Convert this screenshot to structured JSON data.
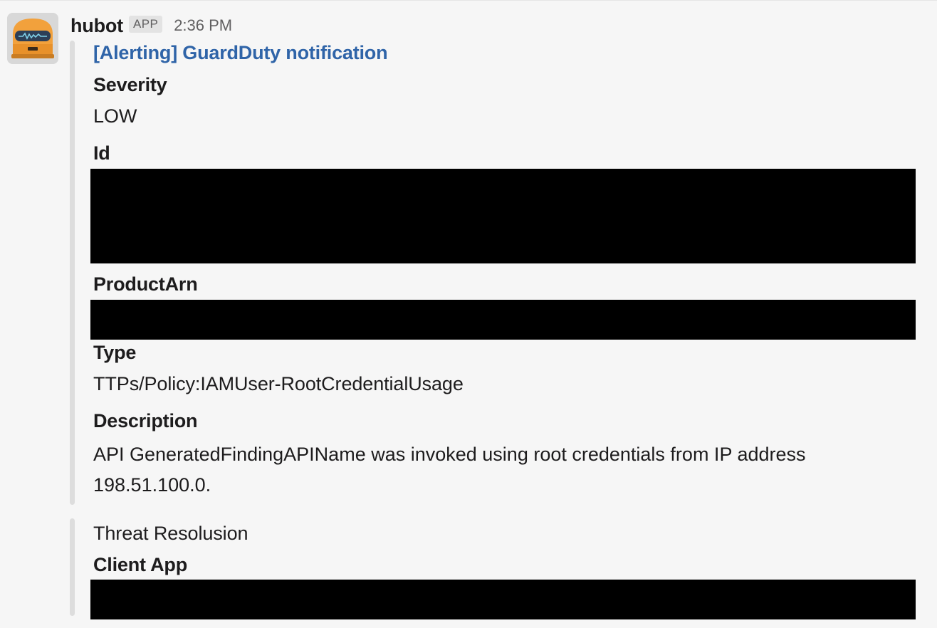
{
  "message": {
    "sender": "hubot",
    "badge": "APP",
    "time": "2:36 PM",
    "avatar_icon": "robot-avatar-icon"
  },
  "attachment1": {
    "title": "[Alerting] GuardDuty notification",
    "fields": {
      "severity_label": "Severity",
      "severity_value": "LOW",
      "id_label": "Id",
      "product_arn_label": "ProductArn",
      "type_label": "Type",
      "type_value": "TTPs/Policy:IAMUser-RootCredentialUsage",
      "description_label": "Description",
      "description_value": "API GeneratedFindingAPIName was invoked using root credentials from IP address 198.51.100.0."
    }
  },
  "attachment2": {
    "text": "Threat Resolusion",
    "client_app_label": "Client App"
  },
  "colors": {
    "link": "#2f64a8",
    "text": "#1d1c1d",
    "muted": "#616061",
    "bar": "#dddddd",
    "redaction": "#000000"
  }
}
